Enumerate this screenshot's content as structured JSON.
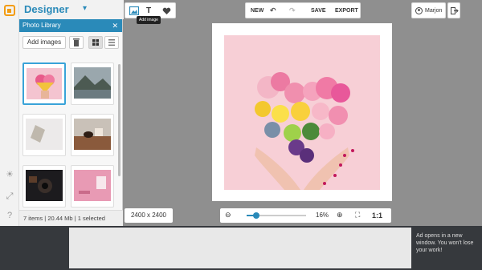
{
  "brand": {
    "name": "Designer",
    "chevron": "▾",
    "logo_icon": "designer-logo-icon"
  },
  "panel": {
    "title": "Photo Library",
    "close_glyph": "✕",
    "add_images_label": "Add images",
    "icons": [
      "trash-icon",
      "grid-view-icon",
      "list-view-icon"
    ],
    "thumbnails": [
      {
        "name": "heart-flowers",
        "selected": true
      },
      {
        "name": "mountain-lake",
        "selected": false
      },
      {
        "name": "price-tag",
        "selected": false
      },
      {
        "name": "coffee-table",
        "selected": false
      },
      {
        "name": "camera-gear",
        "selected": false
      },
      {
        "name": "pink-desk",
        "selected": false
      }
    ],
    "status": {
      "items": "7 items",
      "size": "20.44 Mb",
      "selected": "1 selected",
      "sep": "|"
    }
  },
  "rail": {
    "icons": [
      "bulb-icon",
      "fullscreen-icon",
      "help-icon"
    ]
  },
  "toolbar": {
    "left_icons": [
      "image-icon",
      "text-icon",
      "heart-icon"
    ],
    "tooltip": "Add image",
    "new_label": "NEW",
    "undo_icon": "undo-icon",
    "redo_icon": "redo-icon",
    "save_label": "SAVE",
    "export_label": "EXPORT",
    "user_name": "Marjon",
    "user_icon": "user-icon",
    "exit_icon": "logout-icon"
  },
  "canvas": {
    "dimensions": "2400 x 2400",
    "zoom_percent": "16%",
    "zoom_level": 0.16,
    "fit_label": "1:1"
  },
  "ad": {
    "text": "Ad opens in a new window. You won't lose your work!"
  },
  "colors": {
    "accent": "#2a8ab9",
    "logo": "#f39c12",
    "art_bg": "#f7cfd6"
  }
}
